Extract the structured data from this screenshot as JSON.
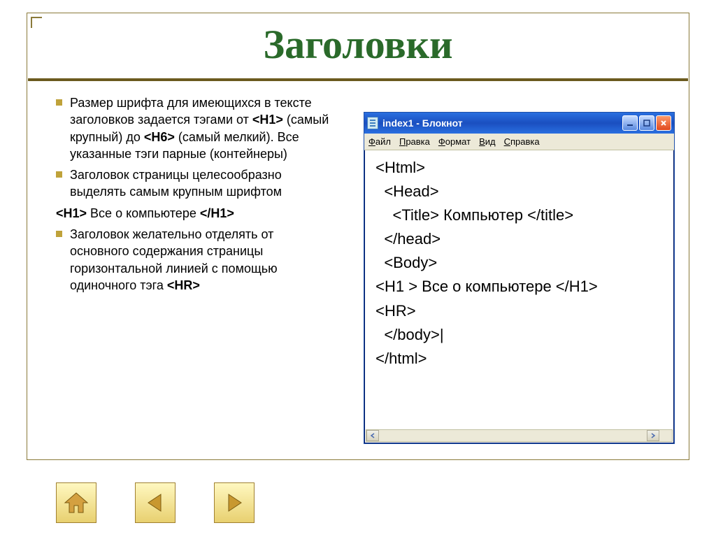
{
  "slide": {
    "title": "Заголовки",
    "bullets": [
      {
        "type": "bullet",
        "html": "Размер шрифта для имеющихся в тексте заголовков задается тэгами от <b>&lt;H1&gt;</b> (самый крупный) до <b>&lt;H6&gt;</b> (самый мелкий). Все указанные тэги парные (контейнеры)"
      },
      {
        "type": "bullet",
        "html": "Заголовок страницы целесообразно выделять самым крупным шрифтом"
      },
      {
        "type": "plain",
        "html": "<b>&lt;H1&gt;</b> Все о компьютере <b>&lt;/H1&gt;</b>"
      },
      {
        "type": "bullet",
        "html": "Заголовок желательно отделять от основного содержания страницы горизонтальной линией с помощью одиночного тэга <b>&lt;HR&gt;</b>"
      }
    ]
  },
  "notepad": {
    "window_title": "index1 - Блокнот",
    "menu": [
      "Файл",
      "Правка",
      "Формат",
      "Вид",
      "Справка"
    ],
    "code_lines": [
      " <Html>",
      "   <Head>",
      "     <Title> Компьютер </title>",
      "   </head>",
      "   <Body>",
      " <H1 > Все о компьютере </H1>",
      " <HR>",
      "   </body>|",
      " </html>"
    ]
  },
  "nav": {
    "home": "home-icon",
    "prev": "prev-icon",
    "next": "next-icon"
  }
}
